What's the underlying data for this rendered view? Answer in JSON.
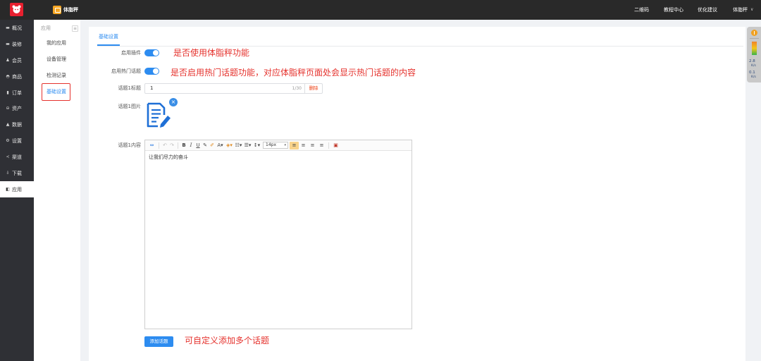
{
  "topbar": {
    "app_name": "体脂秤",
    "links": [
      {
        "label": "二维码"
      },
      {
        "label": "教程中心"
      },
      {
        "label": "优化建议"
      }
    ],
    "user_menu": {
      "label": "体脂秤",
      "icon": "chevron-down-icon",
      "glyph": "∨"
    }
  },
  "sidebar": {
    "items": [
      {
        "label": "概况",
        "icon": "dashboard-icon",
        "glyph": "▬"
      },
      {
        "label": "装修",
        "icon": "decoration-icon",
        "glyph": "▬"
      },
      {
        "label": "会员",
        "icon": "member-icon",
        "glyph": "♟"
      },
      {
        "label": "商品",
        "icon": "goods-icon",
        "glyph": "◓"
      },
      {
        "label": "订单",
        "icon": "order-icon",
        "glyph": "▮"
      },
      {
        "label": "资产",
        "icon": "asset-icon",
        "glyph": "⊖"
      },
      {
        "label": "数据",
        "icon": "data-icon",
        "glyph": "▲"
      },
      {
        "label": "设置",
        "icon": "settings-icon",
        "glyph": "⚙"
      },
      {
        "label": "渠道",
        "icon": "channel-icon",
        "glyph": "≺"
      },
      {
        "label": "下载",
        "icon": "download-icon",
        "glyph": "⇩"
      },
      {
        "label": "应用",
        "icon": "app-icon",
        "glyph": "◧"
      }
    ],
    "active": "应用"
  },
  "subnav": {
    "title": "应用",
    "collapse_glyph": "≡",
    "items": [
      {
        "label": "我的应用"
      },
      {
        "label": "设备管理"
      },
      {
        "label": "检测记录"
      },
      {
        "label": "基础设置"
      }
    ],
    "active": "基础设置"
  },
  "tabs": [
    {
      "label": "基础设置",
      "active": true
    }
  ],
  "form": {
    "enable_plugin": {
      "label": "启用插件",
      "value": true
    },
    "enable_hot_topics": {
      "label": "启用热门话题",
      "value": true
    },
    "topic1_title": {
      "label": "话题1标题",
      "value": "1",
      "counter": "1/30",
      "delete_label": "删除"
    },
    "topic1_image": {
      "label": "话题1图片",
      "remove_glyph": "×",
      "image_icon": "document-edit-icon"
    },
    "topic1_content": {
      "label": "话题1内容",
      "text": "让我们尽力的奋斗",
      "toolbar": {
        "html": {
          "icon": "html-source-icon",
          "glyph": "⇔"
        },
        "undo": {
          "icon": "undo-icon",
          "glyph": "↶"
        },
        "redo": {
          "icon": "redo-icon",
          "glyph": "↷"
        },
        "bold": {
          "icon": "bold-icon",
          "glyph": "B"
        },
        "italic": {
          "icon": "italic-icon",
          "glyph": "I"
        },
        "underline": {
          "icon": "underline-icon",
          "glyph": "U"
        },
        "eraser": {
          "icon": "eraser-icon",
          "glyph": "✎"
        },
        "format_brush": {
          "icon": "format-brush-icon",
          "glyph": "✐"
        },
        "font_color": {
          "icon": "font-color-icon",
          "glyph": "A▾"
        },
        "bg_color": {
          "icon": "background-color-icon",
          "glyph": "◈▾"
        },
        "ordered_list": {
          "icon": "ordered-list-icon",
          "glyph": "☷▾"
        },
        "unordered_list": {
          "icon": "unordered-list-icon",
          "glyph": "☰▾"
        },
        "line_height": {
          "icon": "line-height-icon",
          "glyph": "↕▾"
        },
        "font_size": "14px",
        "font_size_arrow": "▾",
        "align_left": {
          "icon": "align-left-icon",
          "glyph": "≡"
        },
        "align_center": {
          "icon": "align-center-icon",
          "glyph": "≡"
        },
        "align_right": {
          "icon": "align-right-icon",
          "glyph": "≡"
        },
        "align_justify": {
          "icon": "align-justify-icon",
          "glyph": "≡"
        },
        "image": {
          "icon": "insert-image-icon",
          "glyph": "▣"
        }
      }
    },
    "add_topic_label": "添加话题"
  },
  "annotations": {
    "plugin": "是否使用体脂秤功能",
    "hot_topics": "是否启用热门话题功能，对应体脂秤页面处会显示热门话题的内容",
    "add_topic": "可自定义添加多个话题"
  },
  "speed_widget": {
    "down": "2.8",
    "down_unit": "K/s",
    "up": "0.1",
    "up_unit": "K/s"
  },
  "colors": {
    "accent": "#2d8cf0",
    "annotation": "#e5322d",
    "danger": "#ed4014",
    "topbar": "#292929",
    "sidebar": "#2f3035",
    "logo": "#e8202f",
    "app_icon": "#f5a623"
  }
}
